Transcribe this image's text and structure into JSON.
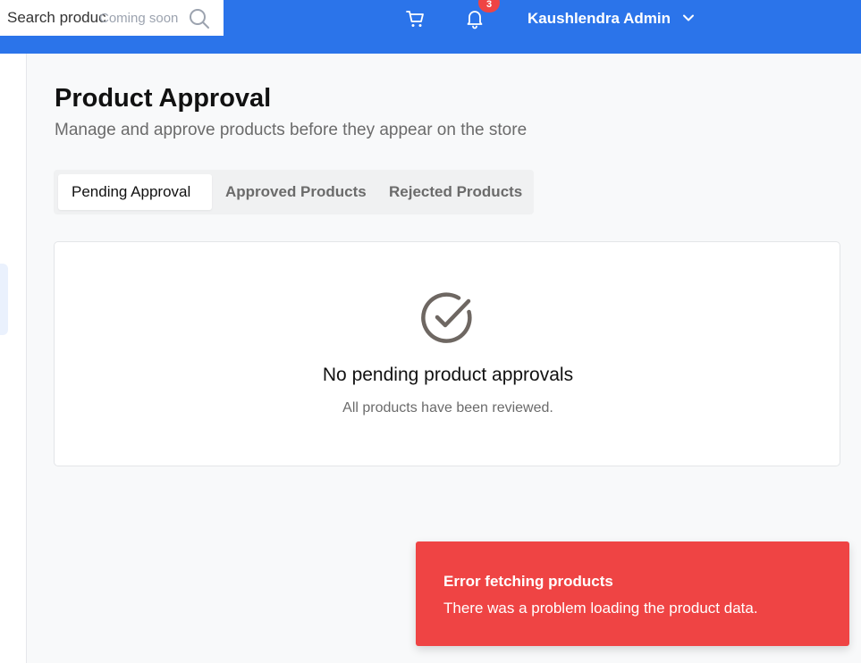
{
  "colors": {
    "header_bg": "#2b74ea",
    "badge_bg": "#ef4444",
    "toast_bg": "#ef4444",
    "page_bg": "#f8f9fa",
    "muted_text": "#6b6b6b"
  },
  "header": {
    "search": {
      "placeholder": "Search products...",
      "hint": "Coming soon",
      "icon": "search-icon"
    },
    "cart_icon": "cart-icon",
    "notifications": {
      "icon": "bell-icon",
      "count": "3"
    },
    "user": {
      "name": "Kaushlendra Admin",
      "icon": "chevron-down-icon"
    }
  },
  "page": {
    "title": "Product Approval",
    "subtitle": "Manage and approve products before they appear on the store"
  },
  "tabs": [
    {
      "label": "Pending Approval",
      "active": true
    },
    {
      "label": "Approved Products",
      "active": false
    },
    {
      "label": "Rejected Products",
      "active": false
    }
  ],
  "empty_state": {
    "icon": "check-circle-icon",
    "title": "No pending product approvals",
    "subtitle": "All products have been reviewed."
  },
  "toast": {
    "title": "Error fetching products",
    "message": "There was a problem loading the product data."
  }
}
